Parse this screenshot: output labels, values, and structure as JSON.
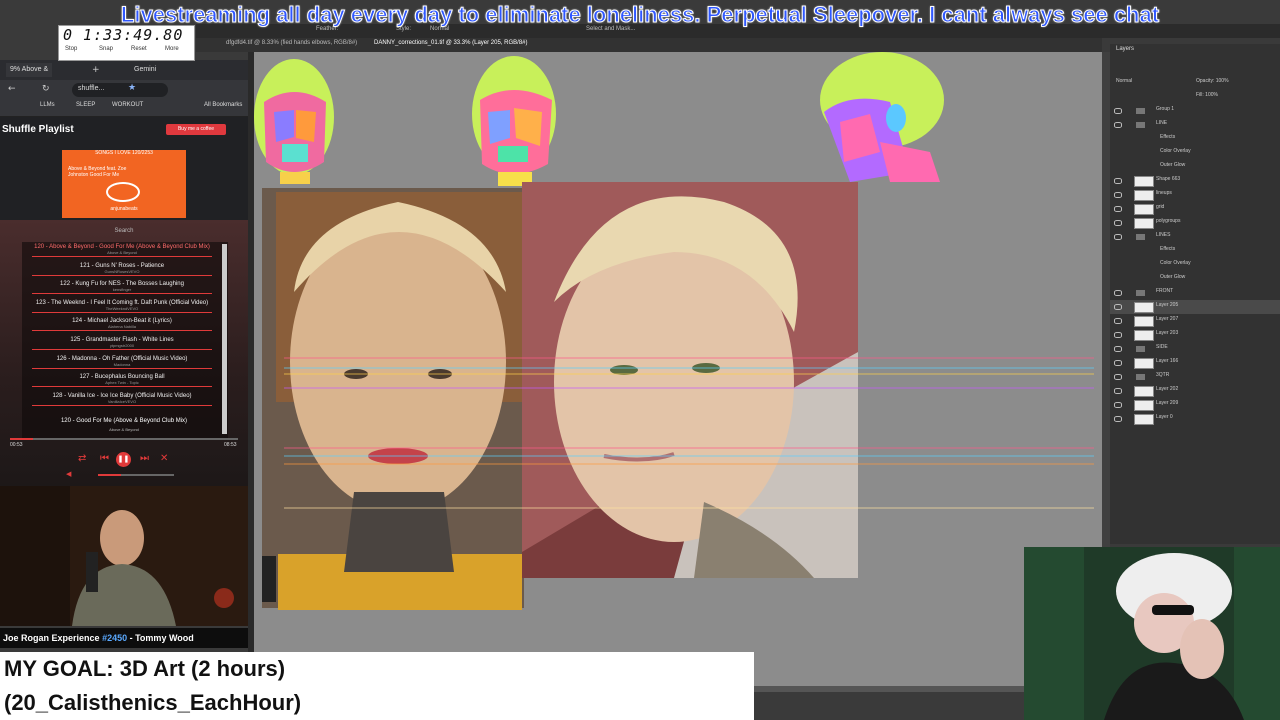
{
  "banner": "Livestreaming all day every day to eliminate loneliness. Perpetual Sleepover. I cant always see chat",
  "timer": {
    "value": "0 1:33:49.80",
    "buttons": [
      "Stop",
      "Snap",
      "Reset",
      "More"
    ]
  },
  "photoshop": {
    "options": [
      "Feather:",
      "Style:",
      "Normal",
      "Select and Mask..."
    ],
    "tabs": [
      "dfgdfd4.tif @ 8.33% (fied hands elbows, RGB/8#)",
      "DANNY_corrections_01.tif @ 33.3% (Layer 205, RGB/8#)"
    ],
    "panel_title": "Layers",
    "blend_mode": "Normal",
    "opacity": "Opacity: 100%",
    "fill": "Fill: 100%",
    "layers": [
      {
        "name": "Group 1",
        "type": "folder"
      },
      {
        "name": "LINE",
        "type": "folder"
      },
      {
        "name": "Effects",
        "type": "fx"
      },
      {
        "name": "Color Overlay",
        "type": "fx"
      },
      {
        "name": "Outer Glow",
        "type": "fx"
      },
      {
        "name": "Shape 663",
        "type": "layer"
      },
      {
        "name": "lineups",
        "type": "layer"
      },
      {
        "name": "grid",
        "type": "layer"
      },
      {
        "name": "polygroups",
        "type": "layer"
      },
      {
        "name": "LINES",
        "type": "folder"
      },
      {
        "name": "Effects",
        "type": "fx"
      },
      {
        "name": "Color Overlay",
        "type": "fx"
      },
      {
        "name": "Outer Glow",
        "type": "fx"
      },
      {
        "name": "FRONT",
        "type": "folder"
      },
      {
        "name": "Layer 205",
        "type": "layer"
      },
      {
        "name": "Layer 207",
        "type": "layer"
      },
      {
        "name": "Layer 203",
        "type": "layer"
      },
      {
        "name": "SIDE",
        "type": "folder"
      },
      {
        "name": "Layer 166",
        "type": "layer"
      },
      {
        "name": "3QTR",
        "type": "folder"
      },
      {
        "name": "Layer 202",
        "type": "layer"
      },
      {
        "name": "Layer 209",
        "type": "layer"
      },
      {
        "name": "Layer 0",
        "type": "layer"
      }
    ]
  },
  "browser": {
    "tabs": [
      "9% Above &",
      "Gemini"
    ],
    "address": "shuffle...",
    "bookmarks": [
      "LLMs",
      "SLEEP",
      "WORKOUT",
      "All Bookmarks"
    ]
  },
  "player": {
    "title": "Shuffle Playlist",
    "coffee_button": "Buy me a coffee",
    "album_header": "SONGS I LOVE 120/2253",
    "album_title": "Above & Beyond feat. Zoe Johnston Good For Me",
    "album_label": "anjunabeats",
    "search_label": "Search",
    "songs": [
      {
        "title": "120 - Above & Beyond - Good For Me (Above & Beyond Club Mix)",
        "artist": "Above & Beyond"
      },
      {
        "title": "121 - Guns N' Roses - Patience",
        "artist": "GunsNRosesVEVO"
      },
      {
        "title": "122 - Kung Fu for NES - The Bosses Laughing",
        "artist": "kensfinger"
      },
      {
        "title": "123 - The Weeknd - I Feel It Coming ft. Daft Punk (Official Video)",
        "artist": "TheWeekndVEVO"
      },
      {
        "title": "124 - Michael Jackson-Beat it (Lyrics)",
        "artist": "Alahena Nabilla"
      },
      {
        "title": "125 - Grandmaster Flash - White Lines",
        "artist": "ytpmgstr2000"
      },
      {
        "title": "126 - Madonna - Oh Father (Official Music Video)",
        "artist": "Madonna"
      },
      {
        "title": "127 - Bucephalus Bouncing Ball",
        "artist": "Aphex Twin - Topic"
      },
      {
        "title": "128 - Vanilla Ice - Ice Ice Baby (Official Music Video)",
        "artist": "VanillaIceVEVO"
      }
    ],
    "now_playing": "120 - Good For Me (Above & Beyond Club Mix)",
    "now_playing_artist": "Above & Beyond",
    "time_elapsed": "00:53",
    "time_total": "08:53",
    "progress": 0.1,
    "volume": 0.3
  },
  "podcast": {
    "show": "Joe Rogan Experience",
    "episode": "#2450",
    "guest": "- Tommy Wood"
  },
  "goal": {
    "line1": "MY GOAL: 3D Art (2 hours)",
    "line2": "(20_Calisthenics_EachHour)"
  },
  "colors": {
    "banner_text": "#2f57ff",
    "accent_red": "#e03a3a",
    "album_orange": "#f26522",
    "canvas_gray": "#8c8c8c"
  }
}
